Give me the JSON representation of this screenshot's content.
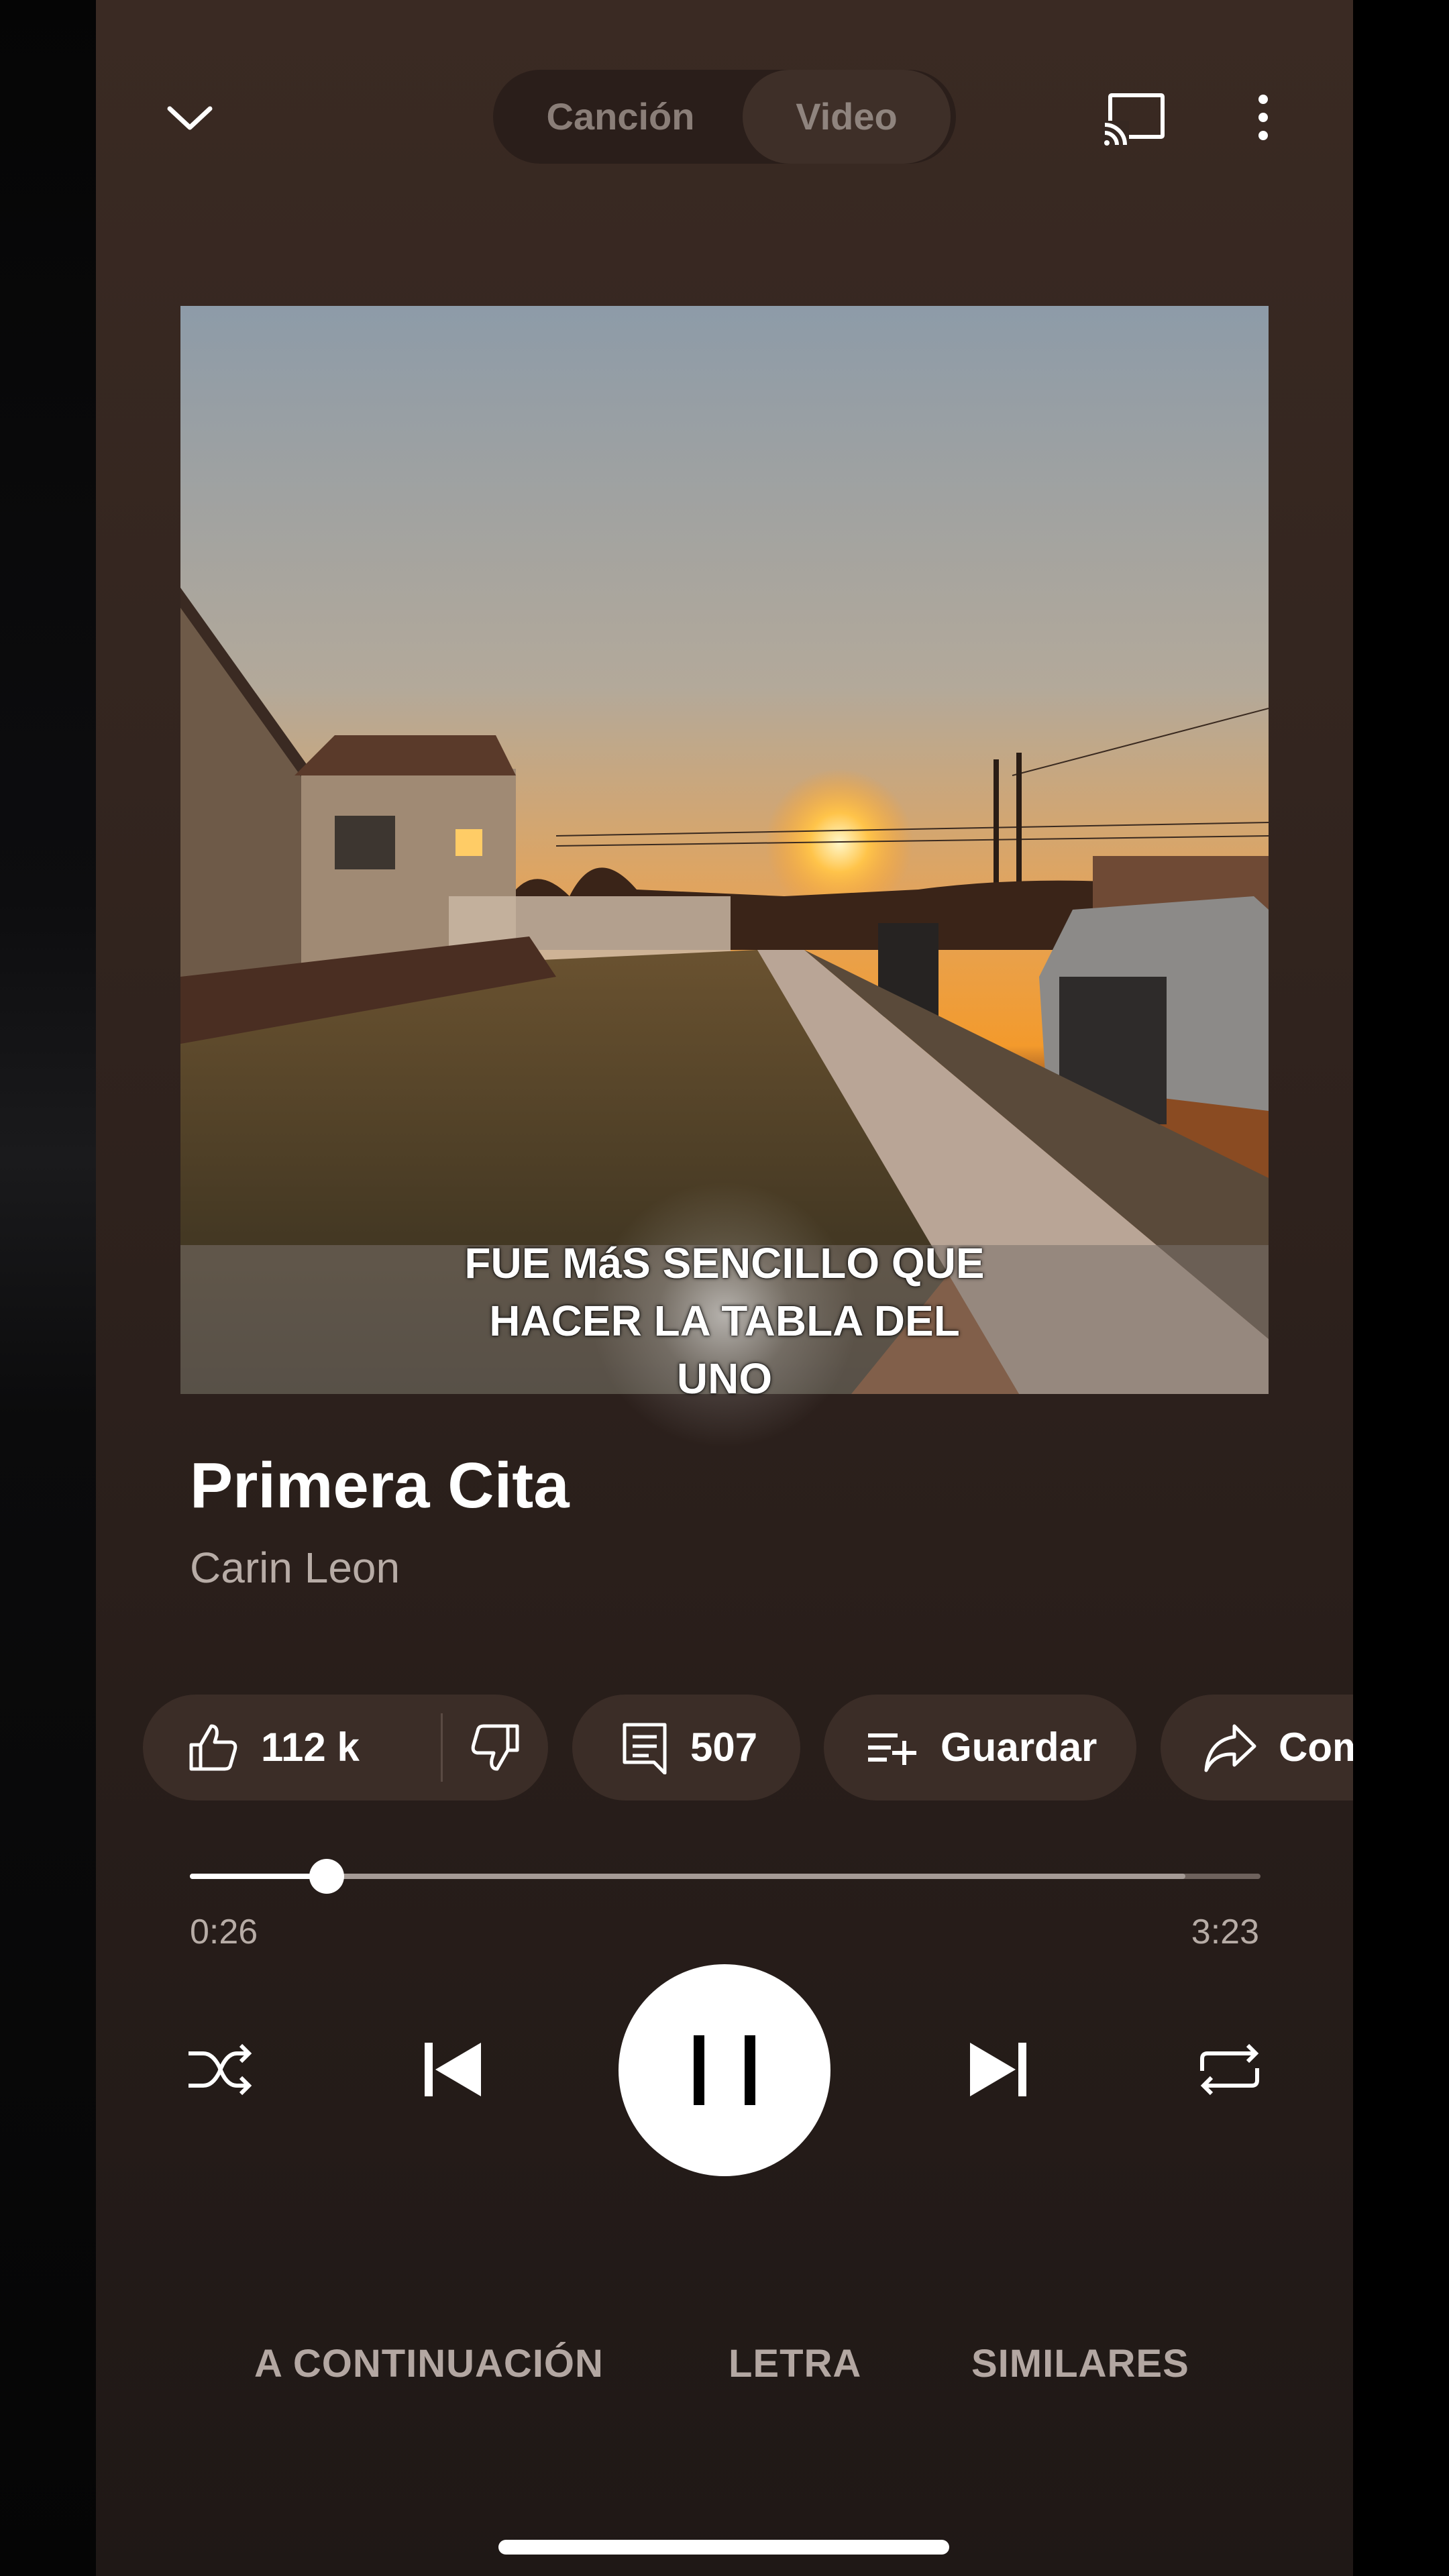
{
  "header": {
    "toggle": {
      "song_label": "Canción",
      "video_label": "Video",
      "selected": "Video"
    },
    "icons": {
      "collapse": "chevron-down-icon",
      "cast": "cast-icon",
      "more": "more-vertical-icon"
    }
  },
  "artwork": {
    "caption_lines": [
      "FUE MáS SENCILLO QUE",
      "HACER LA TABLA DEL",
      "UNO"
    ]
  },
  "track": {
    "title": "Primera Cita",
    "artist": "Carin Leon"
  },
  "actions": {
    "likes": "112 k",
    "comments": "507",
    "save_label": "Guardar",
    "share_label": "Compartir"
  },
  "playback": {
    "current_time": "0:26",
    "total_time": "3:23",
    "progress_fraction": 0.128,
    "buffered_fraction": 0.93,
    "state": "playing"
  },
  "tabs": [
    "A CONTINUACIÓN",
    "LETRA",
    "SIMILARES"
  ],
  "colors": {
    "background_top": "#3a2a23",
    "background_bottom": "#1f1816",
    "chip": "#3b2d27",
    "accent": "#ffffff",
    "muted_text": "#b7aca6"
  }
}
